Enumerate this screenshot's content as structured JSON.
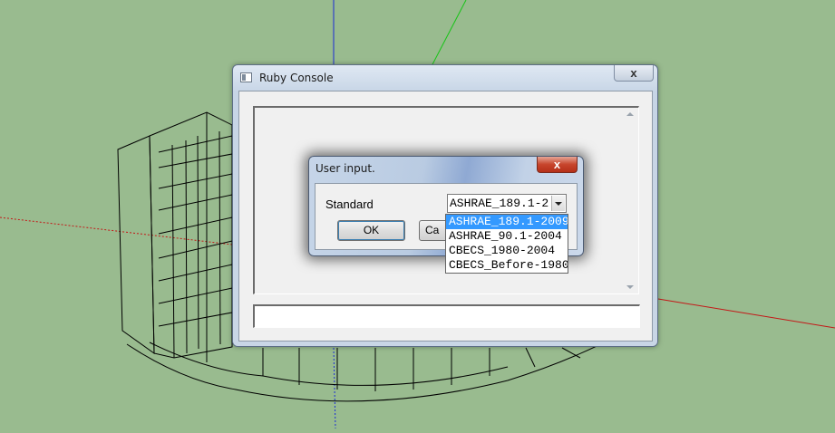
{
  "console_window": {
    "title": "Ruby Console",
    "close_label": "x"
  },
  "dialog": {
    "title": "User input.",
    "close_label": "x",
    "field_label": "Standard",
    "select_value": "ASHRAE_189.1-2",
    "ok_label": "OK",
    "cancel_label": "Ca"
  },
  "dropdown": {
    "options": [
      "ASHRAE_189.1-2009",
      "ASHRAE_90.1-2004",
      "CBECS_1980-2004",
      "CBECS_Before-1980"
    ],
    "selected_index": 0
  },
  "colors": {
    "viewport_background": "#99bb8f",
    "selection_highlight": "#3399ff",
    "dialog_close": "#c7452c"
  }
}
